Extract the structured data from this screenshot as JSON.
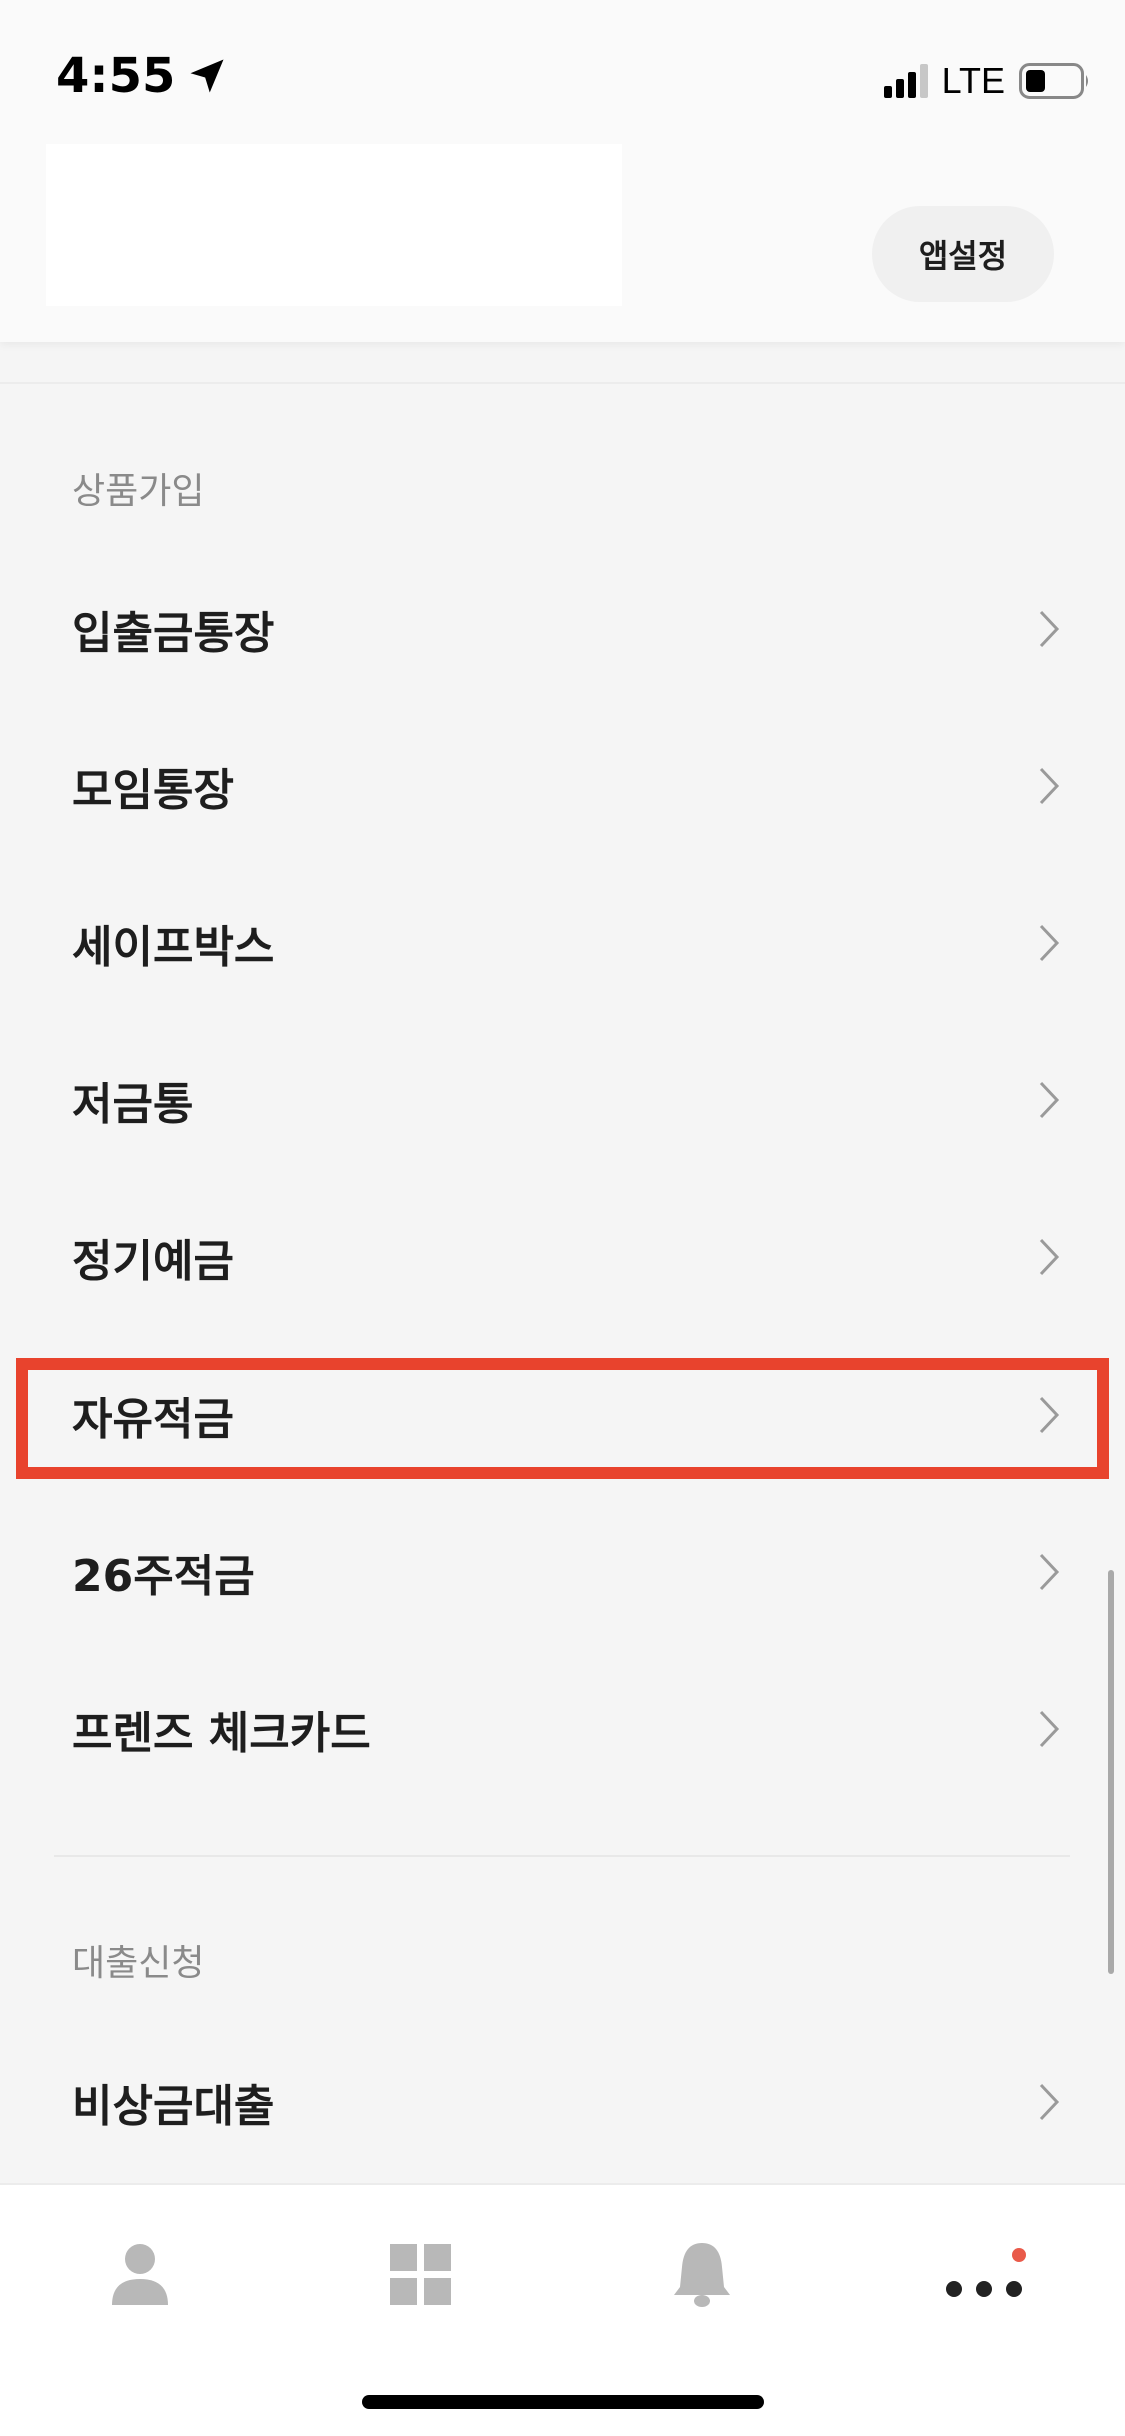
{
  "status_bar": {
    "time": "4:55",
    "network": "LTE",
    "icons": [
      "location-arrow-icon",
      "signal-icon",
      "battery-icon"
    ]
  },
  "header": {
    "settings_button": "앱설정"
  },
  "sections": [
    {
      "label": "상품가입",
      "items": [
        {
          "label": "입출금통장"
        },
        {
          "label": "모임통장"
        },
        {
          "label": "세이프박스"
        },
        {
          "label": "저금통"
        },
        {
          "label": "정기예금"
        },
        {
          "label": "자유적금",
          "highlighted": true
        },
        {
          "label": "26주적금"
        },
        {
          "label": "프렌즈 체크카드"
        }
      ]
    },
    {
      "label": "대출신청",
      "items": [
        {
          "label": "비상금대출"
        }
      ]
    }
  ],
  "tabbar": {
    "tabs": [
      {
        "icon": "person-icon"
      },
      {
        "icon": "grid-icon"
      },
      {
        "icon": "bell-icon"
      },
      {
        "icon": "more-dots-icon",
        "badge": true
      }
    ]
  },
  "colors": {
    "highlight": "#e8432d",
    "badge": "#e95a4a",
    "tab_icon": "#b8b8b8"
  }
}
